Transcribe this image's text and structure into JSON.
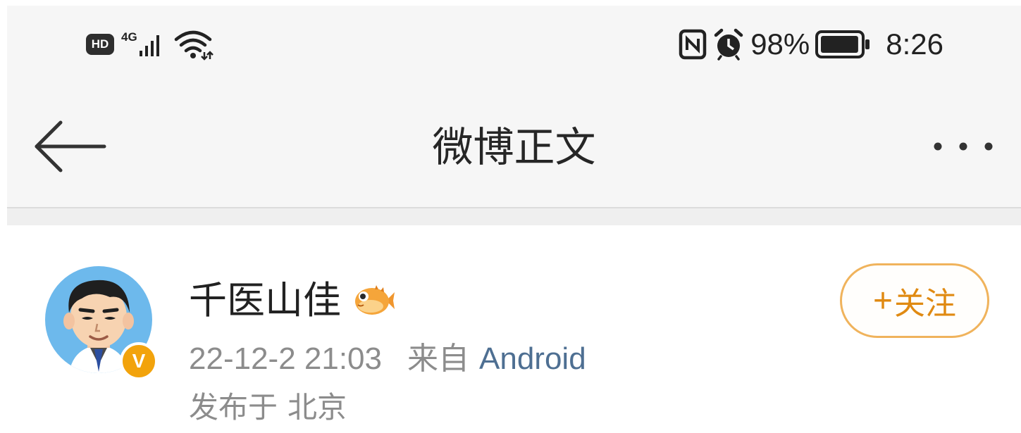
{
  "status_bar": {
    "hd_label": "HD",
    "network_label": "4G",
    "battery": "98%",
    "time": "8:26",
    "icons": [
      "hd-icon",
      "signal-icon",
      "wifi-icon",
      "nfc-icon",
      "alarm-icon",
      "battery-icon"
    ],
    "battery_level": 0.98
  },
  "nav": {
    "title": "微博正文",
    "back_icon": "arrow-left-icon",
    "more_icon": "more-dots-icon"
  },
  "post": {
    "username": "千医山佳",
    "badge_icon": "pufferfish-badge-icon",
    "verified_mark": "V",
    "verified_color": "#f2a30c",
    "timestamp": "22-12-2 21:03",
    "source_label": "来自",
    "source_name": "Android",
    "location_label": "发布于",
    "location_city": "北京",
    "follow_button_label": "关注",
    "follow_button_prefix": "+"
  },
  "colors": {
    "topbar_bg": "#f6f6f6",
    "follow_accent": "#e08a12",
    "follow_border": "#f0b35c",
    "link_color": "#4e6f92",
    "meta_gray": "#8c8c8c",
    "avatar_bg": "#6db9ec"
  }
}
